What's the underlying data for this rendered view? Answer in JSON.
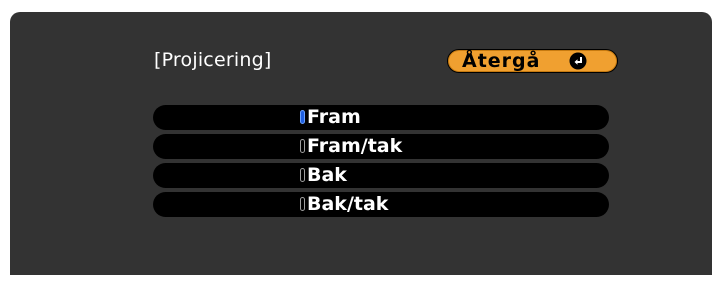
{
  "menu": {
    "title": "[Projicering]",
    "back_label": "Återgå",
    "back_icon": "enter-key-icon",
    "options": [
      {
        "label": "Fram",
        "selected": true
      },
      {
        "label": "Fram/tak",
        "selected": false
      },
      {
        "label": "Bak",
        "selected": false
      },
      {
        "label": "Bak/tak",
        "selected": false
      }
    ]
  },
  "colors": {
    "panel": "#333333",
    "button": "#f0a030",
    "option_bg": "#000000",
    "selected_radio": "#1f5fe0"
  }
}
